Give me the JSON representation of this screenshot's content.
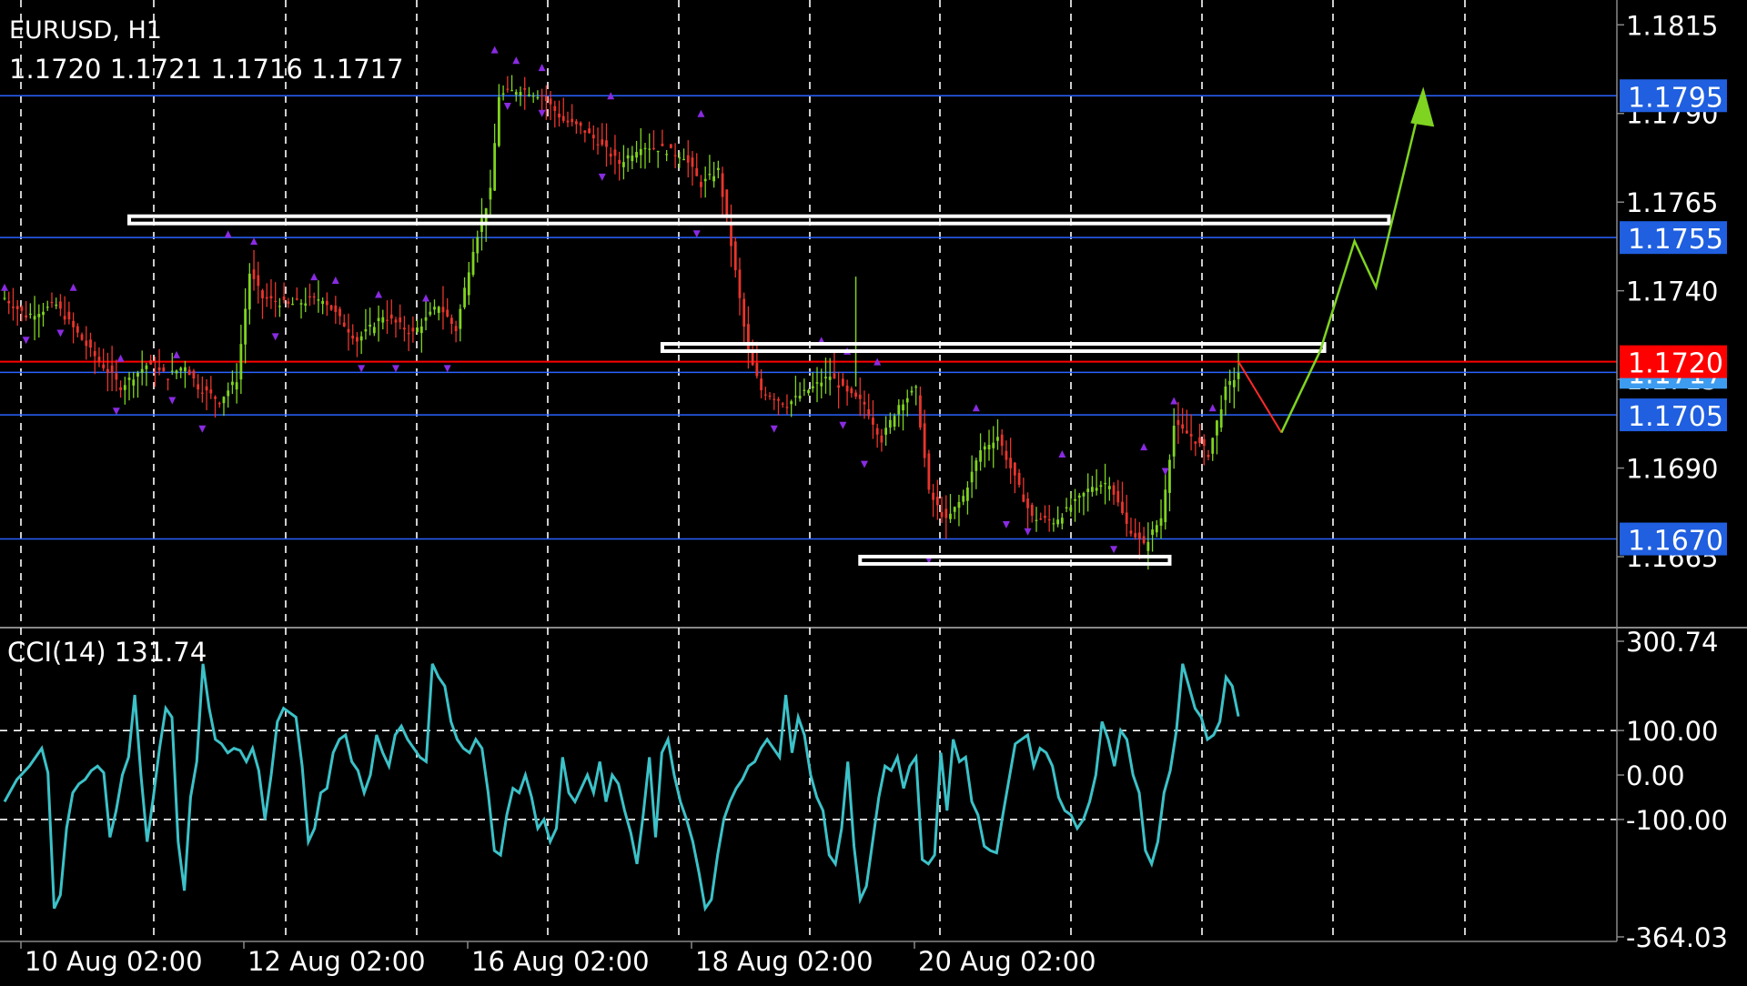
{
  "header": {
    "symbol_timeframe": "EURUSD, H1",
    "ohlc": "1.1720 1.1721 1.1716 1.1717"
  },
  "chart_data": [
    {
      "type": "candlestick",
      "title": "EURUSD, H1",
      "ohlc_readout": {
        "open": 1.172,
        "high": 1.1721,
        "low": 1.1716,
        "close": 1.1717
      },
      "ylim": [
        1.1645,
        1.1822
      ],
      "y_ticks": [
        "1.1815",
        "1.1790",
        "1.1765",
        "1.1740",
        "1.1715",
        "1.1690",
        "1.1665"
      ],
      "x_tick_labels": [
        "10 Aug 02:00",
        "12 Aug 02:00",
        "16 Aug 02:00",
        "18 Aug 02:00",
        "20 Aug 02:00"
      ],
      "grid": true,
      "grid_style": "dashed",
      "colors": {
        "up": "#7fd321",
        "down": "#e8352c",
        "fractal": "#8a2be2",
        "grid": "#ffffff"
      },
      "price_path": [
        [
          0,
          1.1738
        ],
        [
          5,
          1.1733
        ],
        [
          12,
          1.1736
        ],
        [
          20,
          1.1723
        ],
        [
          27,
          1.1713
        ],
        [
          33,
          1.1719
        ],
        [
          38,
          1.1716
        ],
        [
          42,
          1.1719
        ],
        [
          45,
          1.1713
        ],
        [
          50,
          1.1709
        ],
        [
          54,
          1.1715
        ],
        [
          57,
          1.1745
        ],
        [
          60,
          1.1738
        ],
        [
          66,
          1.1736
        ],
        [
          74,
          1.1738
        ],
        [
          82,
          1.1726
        ],
        [
          88,
          1.1733
        ],
        [
          95,
          1.1728
        ],
        [
          101,
          1.1736
        ],
        [
          105,
          1.1729
        ],
        [
          109,
          1.1752
        ],
        [
          113,
          1.1768
        ],
        [
          115,
          1.1795
        ],
        [
          120,
          1.1797
        ],
        [
          125,
          1.1795
        ],
        [
          130,
          1.1788
        ],
        [
          134,
          1.1786
        ],
        [
          138,
          1.1782
        ],
        [
          143,
          1.1776
        ],
        [
          148,
          1.1781
        ],
        [
          153,
          1.178
        ],
        [
          158,
          1.1778
        ],
        [
          162,
          1.177
        ],
        [
          166,
          1.1774
        ],
        [
          169,
          1.1753
        ],
        [
          173,
          1.1722
        ],
        [
          176,
          1.1712
        ],
        [
          182,
          1.1708
        ],
        [
          187,
          1.1712
        ],
        [
          192,
          1.1716
        ],
        [
          196,
          1.1711
        ],
        [
          200,
          1.1708
        ],
        [
          204,
          1.1698
        ],
        [
          208,
          1.1708
        ],
        [
          212,
          1.1712
        ],
        [
          215,
          1.1683
        ],
        [
          219,
          1.1675
        ],
        [
          223,
          1.1682
        ],
        [
          227,
          1.1695
        ],
        [
          231,
          1.1699
        ],
        [
          235,
          1.1687
        ],
        [
          239,
          1.1676
        ],
        [
          244,
          1.1675
        ],
        [
          248,
          1.1679
        ],
        [
          253,
          1.1685
        ],
        [
          257,
          1.1686
        ],
        [
          261,
          1.1674
        ],
        [
          265,
          1.1668
        ],
        [
          269,
          1.1676
        ],
        [
          272,
          1.1702
        ],
        [
          276,
          1.1699
        ],
        [
          280,
          1.1694
        ],
        [
          284,
          1.1712
        ],
        [
          287,
          1.1717
        ]
      ],
      "fractal_marks": {
        "above": [
          [
            0,
            1.1741
          ],
          [
            16,
            1.1741
          ],
          [
            27,
            1.1721
          ],
          [
            40,
            1.1722
          ],
          [
            52,
            1.1756
          ],
          [
            58,
            1.1754
          ],
          [
            72,
            1.1744
          ],
          [
            77,
            1.1743
          ],
          [
            87,
            1.1739
          ],
          [
            98,
            1.1738
          ],
          [
            114,
            1.1808
          ],
          [
            119,
            1.1805
          ],
          [
            125,
            1.1803
          ],
          [
            141,
            1.1795
          ],
          [
            162,
            1.179
          ],
          [
            190,
            1.1726
          ],
          [
            196,
            1.1723
          ],
          [
            203,
            1.172
          ],
          [
            226,
            1.1707
          ],
          [
            246,
            1.1694
          ],
          [
            265,
            1.1696
          ],
          [
            272,
            1.1709
          ],
          [
            281,
            1.1707
          ]
        ],
        "below": [
          [
            5,
            1.1726
          ],
          [
            13,
            1.1728
          ],
          [
            26,
            1.1706
          ],
          [
            39,
            1.1709
          ],
          [
            46,
            1.1701
          ],
          [
            63,
            1.1727
          ],
          [
            83,
            1.1718
          ],
          [
            91,
            1.1718
          ],
          [
            103,
            1.1718
          ],
          [
            117,
            1.1792
          ],
          [
            125,
            1.179
          ],
          [
            139,
            1.1772
          ],
          [
            161,
            1.1756
          ],
          [
            179,
            1.1701
          ],
          [
            195,
            1.1702
          ],
          [
            200,
            1.1691
          ],
          [
            215,
            1.1664
          ],
          [
            233,
            1.1674
          ],
          [
            238,
            1.1672
          ],
          [
            258,
            1.1667
          ],
          [
            270,
            1.1689
          ]
        ]
      },
      "horizontal_lines": [
        {
          "price": 1.1795,
          "label": "1.1795",
          "color": "#2962ff"
        },
        {
          "price": 1.1755,
          "label": "1.1755",
          "color": "#2962ff"
        },
        {
          "price": 1.1717,
          "label": "1.1717",
          "color": "#2962ff"
        },
        {
          "price": 1.1705,
          "label": "1.1705",
          "color": "#2962ff"
        },
        {
          "price": 1.167,
          "label": "1.1670",
          "color": "#2962ff"
        },
        {
          "price": 1.172,
          "label": "1.1720",
          "color": "#ff0000"
        }
      ],
      "zones": [
        {
          "from": 29,
          "to": 322,
          "price": 1.176
        },
        {
          "from": 153,
          "to": 307,
          "price": 1.1724
        },
        {
          "from": 199,
          "to": 271,
          "price": 1.1664
        }
      ],
      "projection": {
        "red_path": [
          [
            287,
            1.172
          ],
          [
            297,
            1.17
          ]
        ],
        "green_path": [
          [
            297,
            1.17
          ],
          [
            306,
            1.1723
          ],
          [
            314,
            1.1754
          ],
          [
            319,
            1.1741
          ],
          [
            329,
            1.1791
          ]
        ],
        "arrow_head": [
          330,
          1.1796
        ]
      }
    },
    {
      "type": "line",
      "title": "CCI(14) 131.74",
      "series": [
        {
          "name": "CCI(14)",
          "last_value": 131.74
        }
      ],
      "ylim": [
        -364.03,
        300.74
      ],
      "y_ticks": [
        "300.74",
        "100.00",
        "0.00",
        "-100.00",
        "-364.03"
      ],
      "levels": [
        100,
        -100
      ],
      "color": "#3cc1c8",
      "x_range": [
        0,
        287
      ],
      "values": [
        -60,
        -35,
        -10,
        5,
        20,
        40,
        60,
        5,
        -300,
        -270,
        -120,
        -40,
        -20,
        -10,
        10,
        20,
        5,
        -140,
        -80,
        0,
        40,
        180,
        0,
        -150,
        -50,
        60,
        150,
        130,
        -150,
        -260,
        -50,
        30,
        250,
        150,
        80,
        70,
        50,
        60,
        55,
        30,
        60,
        10,
        -100,
        0,
        120,
        150,
        140,
        130,
        20,
        -150,
        -120,
        -40,
        -30,
        50,
        80,
        90,
        30,
        10,
        -40,
        0,
        90,
        50,
        20,
        90,
        110,
        80,
        60,
        40,
        30,
        250,
        220,
        200,
        120,
        80,
        60,
        50,
        80,
        60,
        -40,
        -170,
        -180,
        -90,
        -30,
        -40,
        0,
        -50,
        -120,
        -100,
        -150,
        -120,
        40,
        -40,
        -60,
        -30,
        0,
        -40,
        30,
        -60,
        0,
        -20,
        -80,
        -130,
        -200,
        -90,
        40,
        -140,
        50,
        80,
        0,
        -60,
        -100,
        -150,
        -220,
        -300,
        -280,
        -180,
        -100,
        -60,
        -30,
        -10,
        20,
        30,
        60,
        80,
        60,
        40,
        180,
        50,
        130,
        90,
        0,
        -50,
        -80,
        -180,
        -200,
        -120,
        30,
        -160,
        -280,
        -250,
        -150,
        -50,
        20,
        10,
        40,
        -30,
        20,
        40,
        -190,
        -200,
        -180,
        50,
        -80,
        80,
        30,
        40,
        -60,
        -90,
        -160,
        -170,
        -175,
        -90,
        -10,
        70,
        80,
        90,
        20,
        60,
        50,
        20,
        -50,
        -80,
        -90,
        -120,
        -100,
        -60,
        0,
        120,
        80,
        20,
        100,
        80,
        0,
        -40,
        -170,
        -200,
        -150,
        -40,
        10,
        100,
        250,
        200,
        150,
        130,
        80,
        90,
        120,
        220,
        200,
        131.74
      ]
    }
  ]
}
